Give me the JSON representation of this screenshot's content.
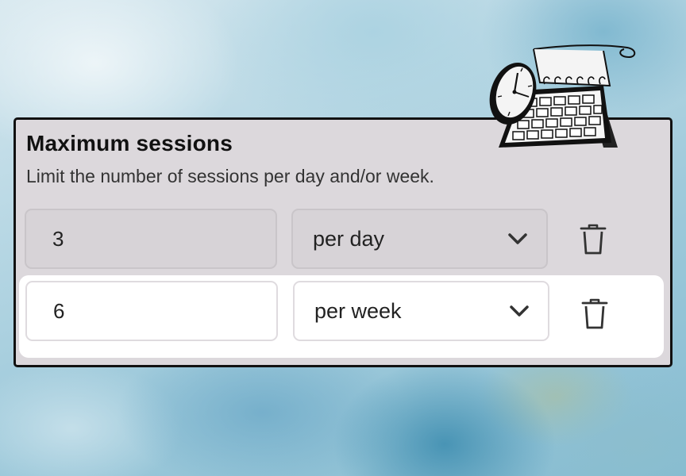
{
  "panel": {
    "title": "Maximum sessions",
    "subtitle": "Limit the number of sessions per day and/or week."
  },
  "rules": [
    {
      "value": "3",
      "period": "per day"
    },
    {
      "value": "6",
      "period": "per week"
    }
  ],
  "icons": {
    "illustration": "calendar-clock-illustration",
    "dropdown": "chevron-down-icon",
    "delete": "trash-icon"
  },
  "colors": {
    "panel_background": "#dcd8dc",
    "panel_border": "#111111",
    "active_row_background": "#ffffff"
  }
}
